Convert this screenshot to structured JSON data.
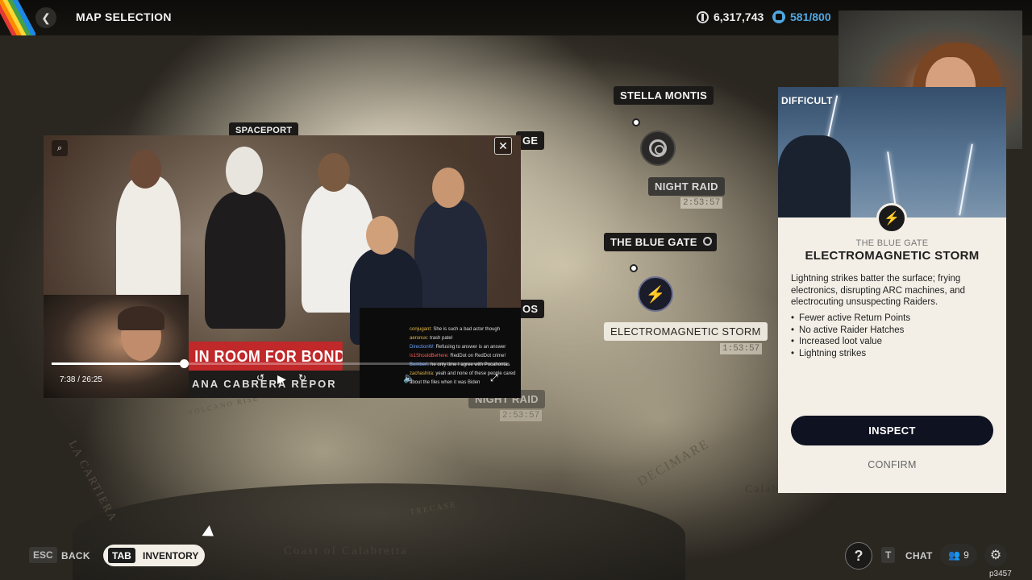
{
  "header": {
    "title": "MAP SELECTION",
    "currency_credits": "6,317,743",
    "currency_cap": "581/800"
  },
  "map": {
    "locations": [
      {
        "name": "STELLA MONTIS"
      },
      {
        "name": "NIGHT RAID",
        "timer": "2:53:57"
      },
      {
        "name": "THE BLUE GATE"
      },
      {
        "name": "ELECTROMAGNETIC STORM",
        "timer": "1:53:57"
      },
      {
        "name": "NIGHT RAID",
        "timer": "2:53:57"
      },
      {
        "name": "SPACEPORT"
      },
      {
        "name": "GE"
      },
      {
        "name": "OS"
      }
    ],
    "region_labels": [
      "LA CARTIERA",
      "DECIMARE",
      "Calabria",
      "Coast of Calabretta",
      "VOLCANO RISE",
      "TRECASE"
    ]
  },
  "video": {
    "time": "7:38 / 26:25",
    "progress": 0.29,
    "banner": "IN ROOM FOR BONDI HEA",
    "banner_sub": "ANA CABRERA REPOR",
    "chat": [
      {
        "user": "conjugant:",
        "msg": "She is such a bad actor though"
      },
      {
        "user": "aeronux:",
        "msg": "trash patel"
      },
      {
        "user": "DirectionW:",
        "msg": "Refusing to answer is an answer"
      },
      {
        "user": "Is1ShouldBeHere:",
        "msg": "RedDot on RedDot crime!"
      },
      {
        "user": "Bombert:",
        "msg": "he only time I agree with Pocahontas"
      },
      {
        "user": "zachashira:",
        "msg": "yeah and none of these people cared about the files when it was Biden"
      }
    ]
  },
  "event_panel": {
    "difficulty_label": "DIFFICULT",
    "location": "THE BLUE GATE",
    "title": "ELECTROMAGNETIC STORM",
    "description": "Lightning strikes batter the surface; frying electronics, disrupting ARC machines, and electrocuting unsuspecting Raiders.",
    "effects": [
      "Fewer active Return Points",
      "No active Raider Hatches",
      "Increased loot value",
      "Lightning strikes"
    ],
    "inspect_label": "INSPECT",
    "confirm_label": "CONFIRM"
  },
  "footer": {
    "back_key": "ESC",
    "back_label": "BACK",
    "inventory_key": "TAB",
    "inventory_label": "INVENTORY",
    "chat_key": "T",
    "chat_label": "CHAT",
    "party_count": "9",
    "corner_tag": "p3457"
  },
  "colors": {
    "accent_blue": "#4fa7e0",
    "panel_bg": "#f3efe6",
    "button_dark": "#0f1220",
    "storm_bolt": "#f5c23a"
  }
}
